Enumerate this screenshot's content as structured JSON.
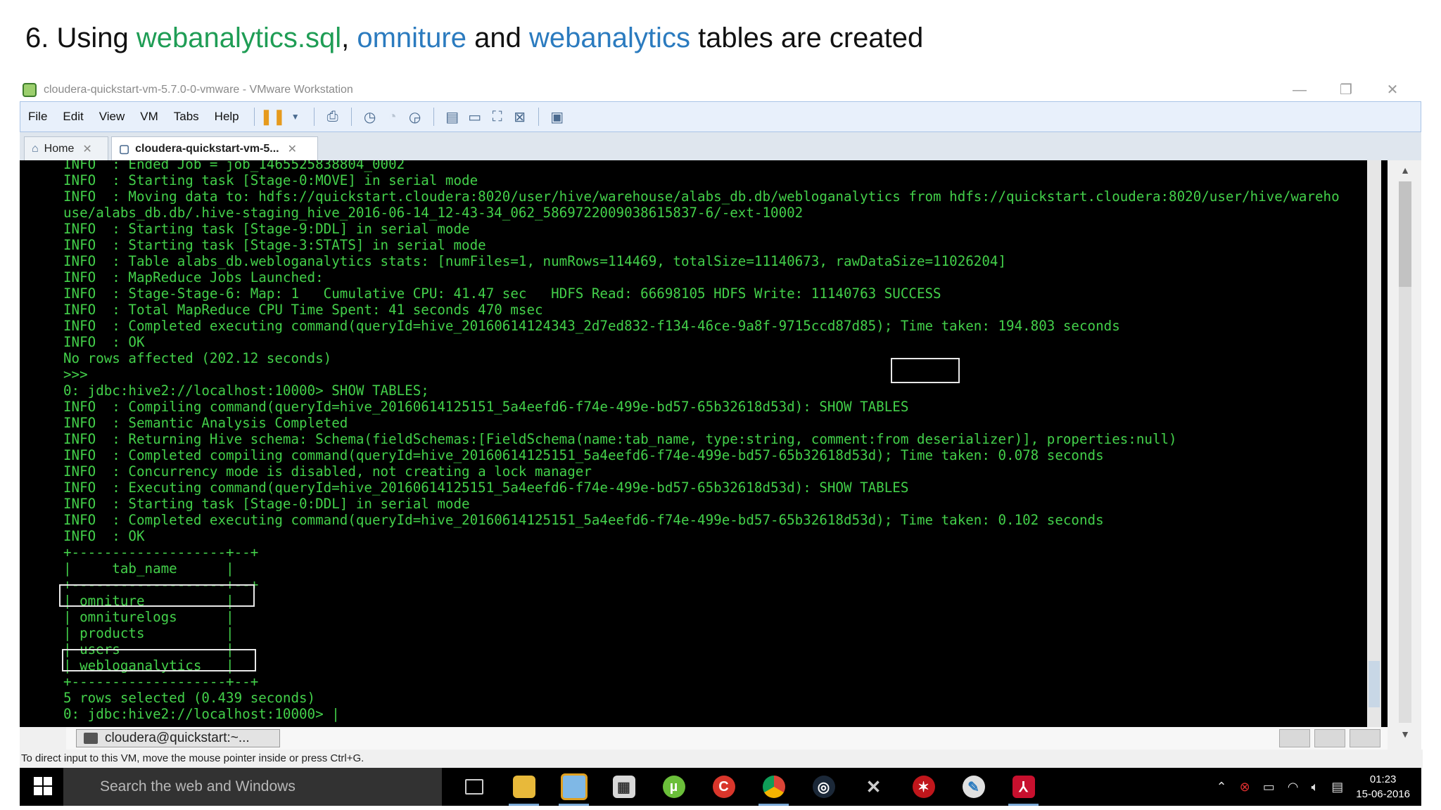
{
  "slide": {
    "title_prefix": "6. Using ",
    "title_file": "webanalytics.sql",
    "title_sep": ", ",
    "title_table1": "omniture",
    "title_and": " and ",
    "title_table2": "webanalytics",
    "title_suffix": " tables are created"
  },
  "window": {
    "title": "cloudera-quickstart-vm-5.7.0-0-vmware - VMware Workstation",
    "controls": [
      "—",
      "❐",
      "✕"
    ]
  },
  "menu": [
    "File",
    "Edit",
    "View",
    "VM",
    "Tabs",
    "Help"
  ],
  "tabs": [
    {
      "label": "Home"
    },
    {
      "label": "cloudera-quickstart-vm-5..."
    }
  ],
  "terminal": {
    "lines": [
      "INFO  : Ended Job = job_1465525838804_0002",
      "INFO  : Starting task [Stage-0:MOVE] in serial mode",
      "INFO  : Moving data to: hdfs://quickstart.cloudera:8020/user/hive/warehouse/alabs_db.db/webloganalytics from hdfs://quickstart.cloudera:8020/user/hive/wareho",
      "use/alabs_db.db/.hive-staging_hive_2016-06-14_12-43-34_062_5869722009038615837-6/-ext-10002",
      "INFO  : Starting task [Stage-9:DDL] in serial mode",
      "INFO  : Starting task [Stage-3:STATS] in serial mode",
      "INFO  : Table alabs_db.webloganalytics stats: [numFiles=1, numRows=114469, totalSize=11140673, rawDataSize=11026204]",
      "INFO  : MapReduce Jobs Launched:",
      "INFO  : Stage-Stage-6: Map: 1   Cumulative CPU: 41.47 sec   HDFS Read: 66698105 HDFS Write: 11140763 SUCCESS",
      "INFO  : Total MapReduce CPU Time Spent: 41 seconds 470 msec",
      "INFO  : Completed executing command(queryId=hive_20160614124343_2d7ed832-f134-46ce-9a8f-9715ccd87d85); Time taken: 194.803 seconds",
      "INFO  : OK",
      "No rows affected (202.12 seconds)",
      ">>>",
      "0: jdbc:hive2://localhost:10000> SHOW TABLES;",
      "INFO  : Compiling command(queryId=hive_20160614125151_5a4eefd6-f74e-499e-bd57-65b32618d53d): SHOW TABLES",
      "INFO  : Semantic Analysis Completed",
      "INFO  : Returning Hive schema: Schema(fieldSchemas:[FieldSchema(name:tab_name, type:string, comment:from deserializer)], properties:null)",
      "INFO  : Completed compiling command(queryId=hive_20160614125151_5a4eefd6-f74e-499e-bd57-65b32618d53d); Time taken: 0.078 seconds",
      "INFO  : Concurrency mode is disabled, not creating a lock manager",
      "INFO  : Executing command(queryId=hive_20160614125151_5a4eefd6-f74e-499e-bd57-65b32618d53d): SHOW TABLES",
      "INFO  : Starting task [Stage-0:DDL] in serial mode",
      "INFO  : Completed executing command(queryId=hive_20160614125151_5a4eefd6-f74e-499e-bd57-65b32618d53d); Time taken: 0.102 seconds",
      "INFO  : OK",
      "+-------------------+--+",
      "|     tab_name      |",
      "+-------------------+--+",
      "| omniture          |",
      "| omniturelogs      |",
      "| products          |",
      "| users             |",
      "| webloganalytics   |",
      "+-------------------+--+",
      "5 rows selected (0.439 seconds)",
      "0: jdbc:hive2://localhost:10000> |"
    ]
  },
  "taskstrip": {
    "button": "cloudera@quickstart:~..."
  },
  "statusbar": {
    "text": "To direct input to this VM, move the mouse pointer inside or press Ctrl+G."
  },
  "taskbar": {
    "search_placeholder": "Search the web and Windows",
    "time": "01:23",
    "date": "15-06-2016"
  },
  "colors": {
    "terminal_bg": "#000000",
    "terminal_text": "#43d04a",
    "title_green": "#1f9d55",
    "title_blue": "#2b7bbf"
  }
}
